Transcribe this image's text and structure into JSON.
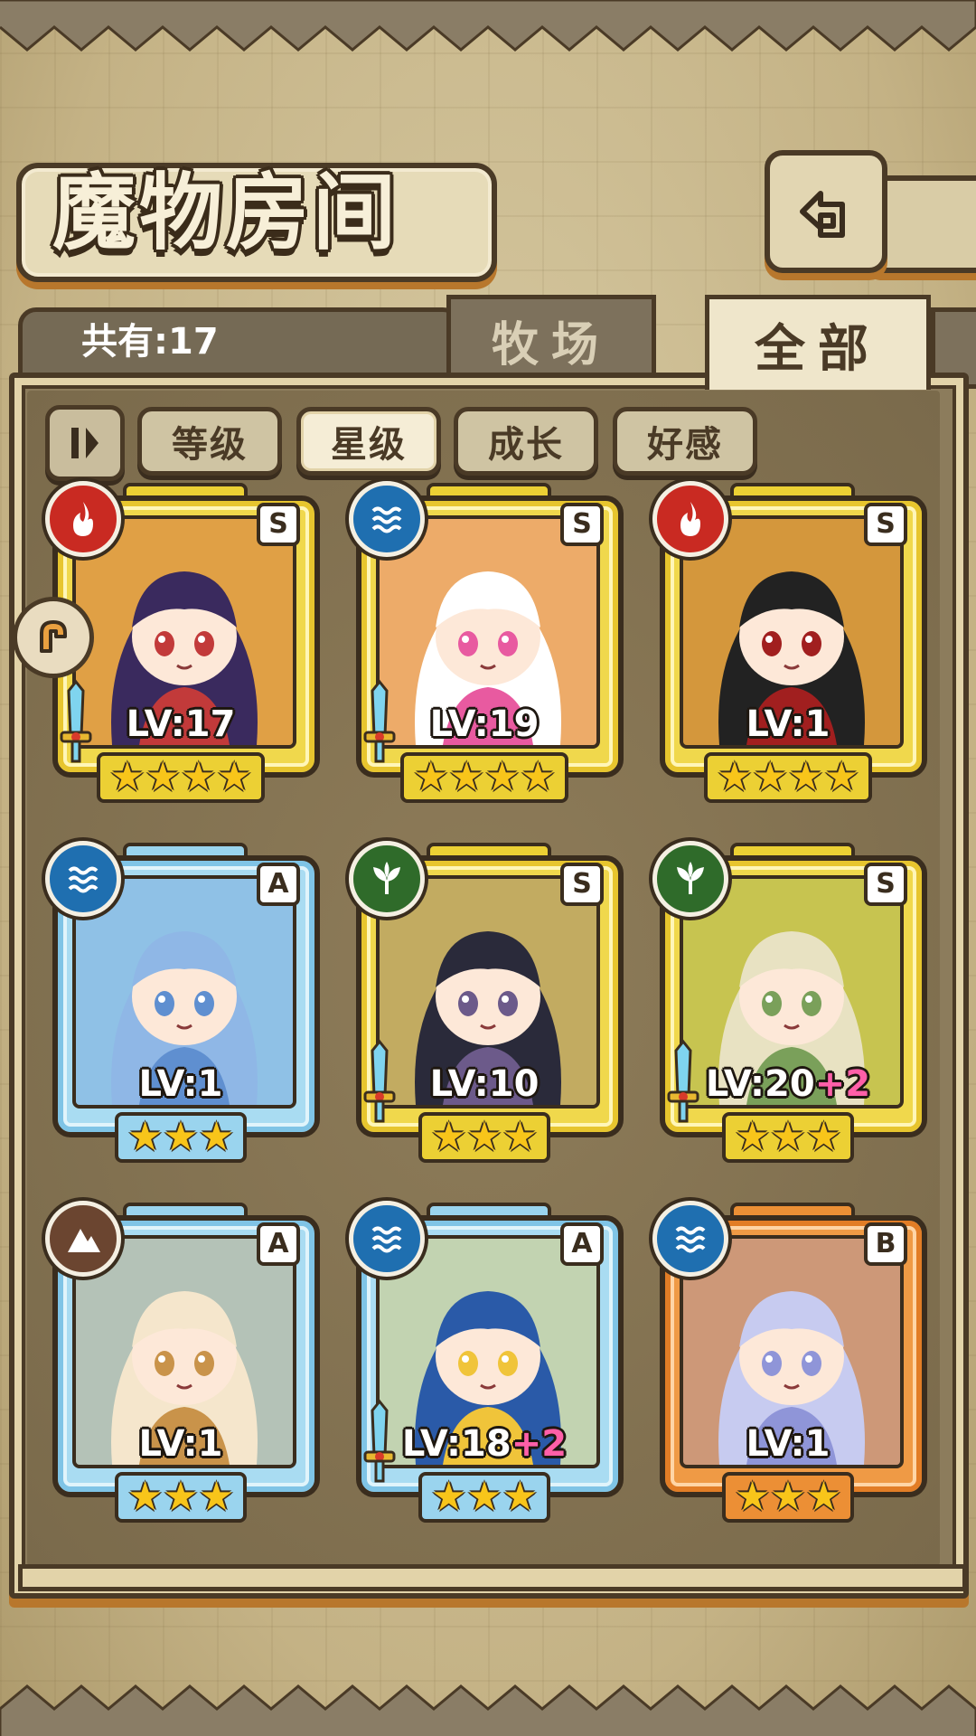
{
  "header": {
    "title": "魔物房间",
    "back_icon": "return-icon"
  },
  "tabs": {
    "count_label": "共有:17",
    "ranch": "牧场",
    "all": "全部"
  },
  "sort": {
    "level": "等级",
    "stars": "星级",
    "growth": "成长",
    "affinity": "好感",
    "active": "星级"
  },
  "monsters": [
    {
      "element": "fire",
      "rank": "S",
      "level": "LV:17",
      "bonus": "",
      "stars": 4,
      "tier": "gold",
      "equipped": true,
      "hair": "#3a2a5e",
      "accent": "#c23a3a"
    },
    {
      "element": "water",
      "rank": "S",
      "level": "LV:19",
      "bonus": "",
      "stars": 4,
      "tier": "gold",
      "equipped": true,
      "hair": "#ffffff",
      "accent": "#e85aa0"
    },
    {
      "element": "fire",
      "rank": "S",
      "level": "LV:1",
      "bonus": "",
      "stars": 4,
      "tier": "gold",
      "equipped": false,
      "hair": "#222222",
      "accent": "#a11f1f"
    },
    {
      "element": "water",
      "rank": "A",
      "level": "LV:1",
      "bonus": "",
      "stars": 3,
      "tier": "blue",
      "equipped": false,
      "hair": "#8fb7e6",
      "accent": "#5f8fd0"
    },
    {
      "element": "wood",
      "rank": "S",
      "level": "LV:10",
      "bonus": "",
      "stars": 3,
      "tier": "gold",
      "equipped": true,
      "hair": "#2a2a3a",
      "accent": "#6c5a8a"
    },
    {
      "element": "wood",
      "rank": "S",
      "level": "LV:20",
      "bonus": "+2",
      "stars": 3,
      "tier": "gold",
      "equipped": true,
      "hair": "#e8e2c2",
      "accent": "#7aa05a"
    },
    {
      "element": "earth",
      "rank": "A",
      "level": "LV:1",
      "bonus": "",
      "stars": 3,
      "tier": "blue",
      "equipped": false,
      "hair": "#f5e6cc",
      "accent": "#c9934a"
    },
    {
      "element": "water",
      "rank": "A",
      "level": "LV:18",
      "bonus": "+2",
      "stars": 3,
      "tier": "blue",
      "equipped": true,
      "hair": "#2a5aa8",
      "accent": "#f0c43a"
    },
    {
      "element": "water",
      "rank": "B",
      "level": "LV:1",
      "bonus": "",
      "stars": 3,
      "tier": "orange",
      "equipped": false,
      "hair": "#c7cbf0",
      "accent": "#8f95d8"
    }
  ]
}
